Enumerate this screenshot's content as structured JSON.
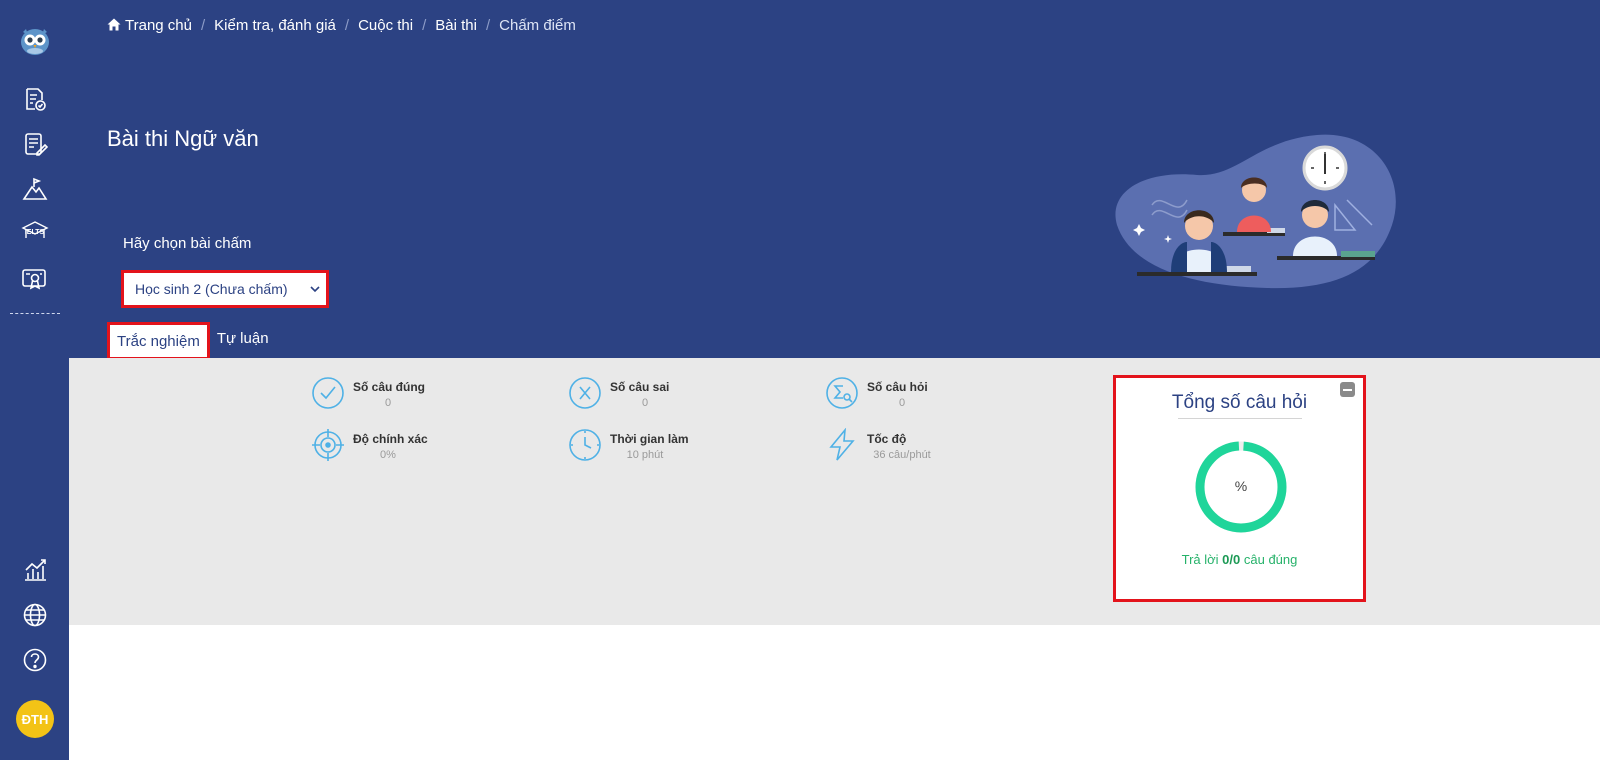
{
  "breadcrumb": [
    {
      "label": "Trang chủ"
    },
    {
      "label": "Kiểm tra, đánh giá"
    },
    {
      "label": "Cuộc thi"
    },
    {
      "label": "Bài thi"
    },
    {
      "label": "Chấm điểm"
    }
  ],
  "page": {
    "title": "Bài thi Ngữ văn",
    "select_label": "Hãy chọn bài chấm",
    "selected_student": "Học sinh 2 (Chưa chấm)"
  },
  "tabs": [
    {
      "label": "Trắc nghiệm",
      "active": true
    },
    {
      "label": "Tự luận",
      "active": false
    }
  ],
  "sidebar": {
    "avatar_initials": "ĐTH",
    "ielts_text": "IELTS"
  },
  "stats": [
    {
      "label": "Số câu đúng",
      "value": "0",
      "icon": "check-circle-icon"
    },
    {
      "label": "Số câu sai",
      "value": "0",
      "icon": "x-circle-icon"
    },
    {
      "label": "Số câu hỏi",
      "value": "0",
      "icon": "sigma-circle-icon"
    },
    {
      "label": "Độ chính xác",
      "value": "0%",
      "icon": "crosshair-icon"
    },
    {
      "label": "Thời gian làm",
      "value": "10 phút",
      "icon": "clock-icon"
    },
    {
      "label": "Tốc độ",
      "value": "36 câu/phút",
      "icon": "lightning-icon"
    }
  ],
  "summary": {
    "title": "Tổng số câu hỏi",
    "percent_symbol": "%",
    "answer_prefix": "Trả lời",
    "answer_value": "0/0",
    "answer_suffix": "câu đúng",
    "progress_fraction": 0.98
  },
  "colors": {
    "navy": "#2c4283",
    "highlight_red": "#e3131b",
    "donut_green": "#1fd59a",
    "accent_blue": "#4fb1e6",
    "avatar_yellow": "#f3c316"
  }
}
